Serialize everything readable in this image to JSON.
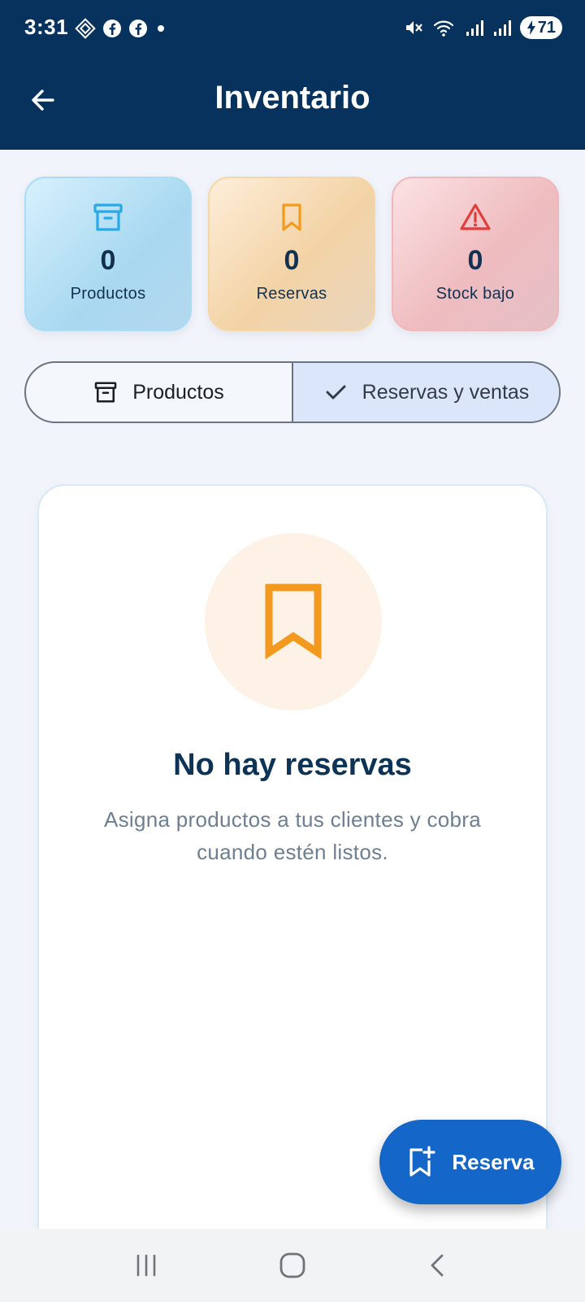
{
  "status_bar": {
    "time": "3:31",
    "left_icons": [
      "assistant-icon",
      "facebook-icon",
      "facebook-icon",
      "dot-icon"
    ],
    "right_icons": [
      "mute-icon",
      "wifi-icon",
      "signal-icon",
      "signal-icon"
    ],
    "battery": "71"
  },
  "app_bar": {
    "title": "Inventario",
    "back_icon": "arrow-left-icon"
  },
  "stats": [
    {
      "icon": "archive-icon",
      "value": "0",
      "label": "Productos",
      "color": "#29a9e8"
    },
    {
      "icon": "bookmark-icon",
      "value": "0",
      "label": "Reservas",
      "color": "#f39a1e"
    },
    {
      "icon": "warning-icon",
      "value": "0",
      "label": "Stock bajo",
      "color": "#e23d3d"
    }
  ],
  "segmented": {
    "options": [
      {
        "label": "Productos",
        "icon": "archive-icon",
        "selected": false
      },
      {
        "label": "Reservas y ventas",
        "icon": "check-icon",
        "selected": true
      }
    ]
  },
  "empty_state": {
    "icon": "bookmark-icon",
    "title": "No hay reservas",
    "description": "Asigna productos a tus clientes y cobra cuando estén listos."
  },
  "fab": {
    "label": "Reserva",
    "icon": "bookmark-add-icon"
  },
  "colors": {
    "header_bg": "#06325d",
    "fab_bg": "#1466c8",
    "bookmark_orange": "#f39a1e"
  },
  "nav_bar": {
    "buttons": [
      "recent-apps-icon",
      "home-icon",
      "back-icon"
    ]
  }
}
